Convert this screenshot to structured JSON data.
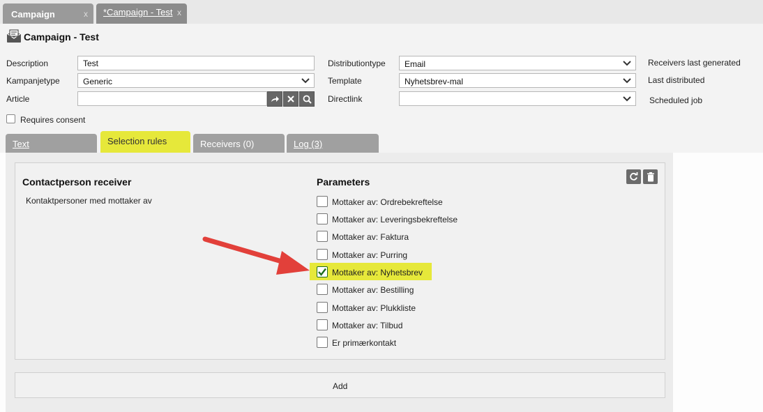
{
  "window_tabs": [
    {
      "label": "Campaign",
      "close": "x"
    },
    {
      "label": "*Campaign - Test",
      "close": "x"
    }
  ],
  "header": {
    "title": "Campaign - Test"
  },
  "form": {
    "description_label": "Description",
    "description_value": "Test",
    "kampanjetype_label": "Kampanjetype",
    "kampanjetype_value": "Generic",
    "article_label": "Article",
    "article_value": "",
    "distributiontype_label": "Distributiontype",
    "distributiontype_value": "Email",
    "template_label": "Template",
    "template_value": "Nyhetsbrev-mal",
    "directlink_label": "Directlink",
    "directlink_value": "",
    "receivers_last_generated": "Receivers last generated",
    "last_distributed": "Last distributed",
    "scheduled_job": "Scheduled job",
    "requires_consent_label": "Requires consent",
    "requires_consent_checked": false
  },
  "section_tabs": [
    {
      "label": "Text"
    },
    {
      "label": "Selection rules"
    },
    {
      "label": "Receivers (0)"
    },
    {
      "label": "Log (3)"
    }
  ],
  "rule": {
    "title": "Contactperson receiver",
    "description": "Kontaktpersoner med mottaker av",
    "parameters_title": "Parameters",
    "parameters": [
      {
        "label": "Mottaker av: Ordrebekreftelse",
        "checked": false
      },
      {
        "label": "Mottaker av: Leveringsbekreftelse",
        "checked": false
      },
      {
        "label": "Mottaker av: Faktura",
        "checked": false
      },
      {
        "label": "Mottaker av: Purring",
        "checked": false
      },
      {
        "label": "Mottaker av: Nyhetsbrev",
        "checked": true
      },
      {
        "label": "Mottaker av: Bestilling",
        "checked": false
      },
      {
        "label": "Mottaker av: Plukkliste",
        "checked": false
      },
      {
        "label": "Mottaker av: Tilbud",
        "checked": false
      },
      {
        "label": "Er primærkontakt",
        "checked": false
      }
    ]
  },
  "add_label": "Add",
  "colors": {
    "highlight": "#e6e83a",
    "arrow": "#e2403a",
    "check": "#1d6b1d"
  }
}
